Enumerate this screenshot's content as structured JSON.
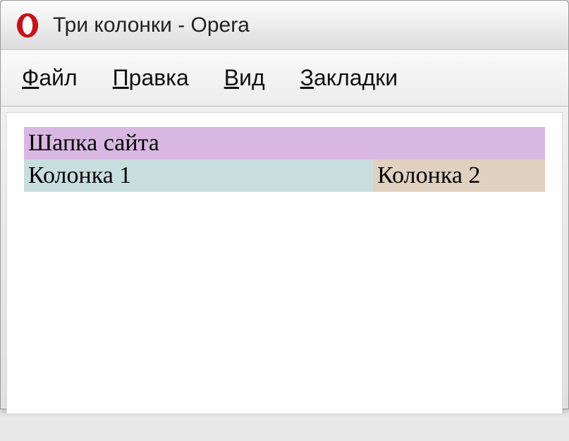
{
  "window": {
    "title": "Три колонки - Opera"
  },
  "menubar": {
    "items": [
      {
        "prefix": "Ф",
        "rest": "айл"
      },
      {
        "prefix": "П",
        "rest": "равка"
      },
      {
        "prefix": "В",
        "rest": "ид"
      },
      {
        "prefix": "З",
        "rest": "акладки"
      }
    ]
  },
  "page": {
    "header": "Шапка сайта",
    "column1": "Колонка 1",
    "column2": "Колонка 2"
  }
}
